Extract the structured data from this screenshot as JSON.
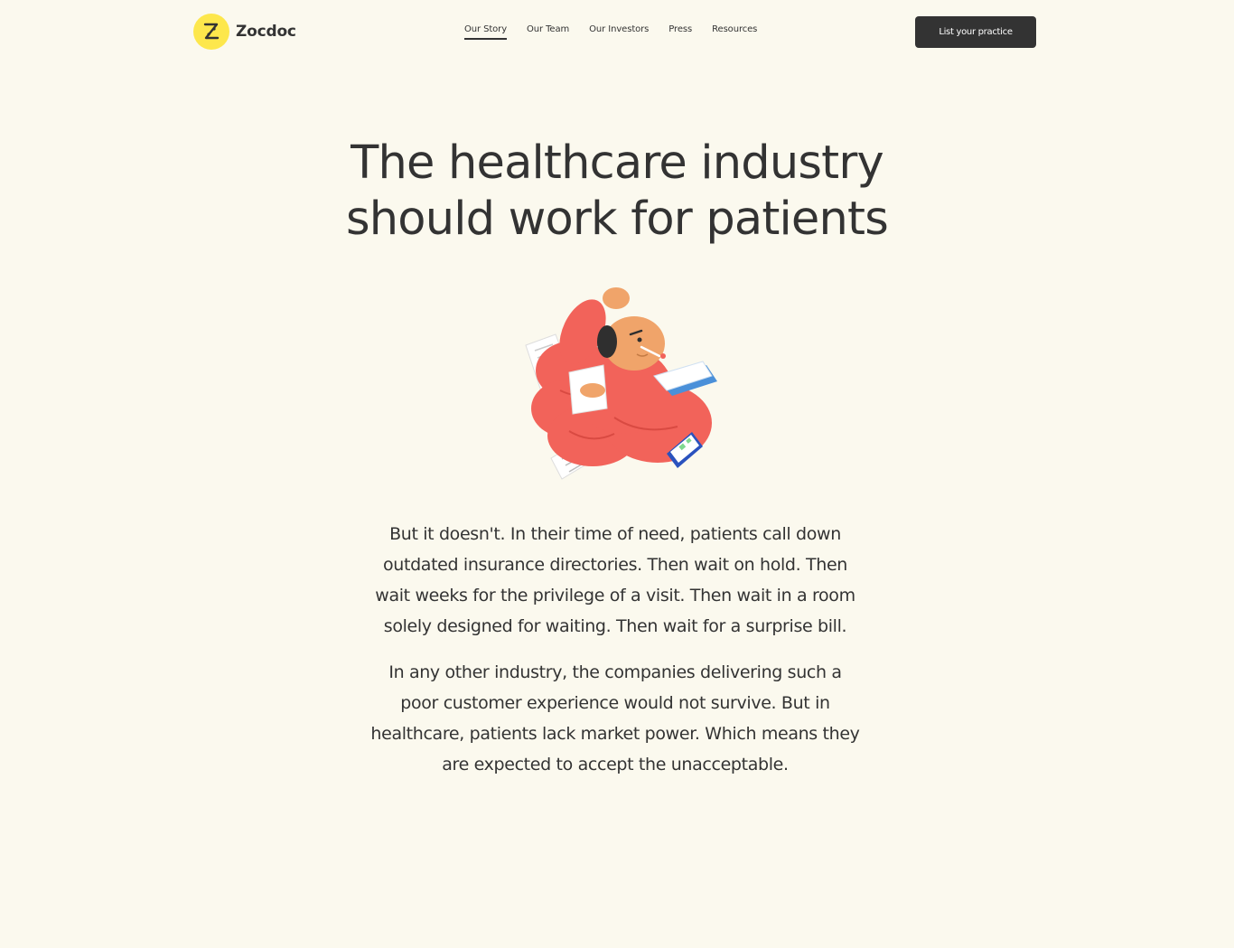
{
  "brand": {
    "name": "Zocdoc",
    "logo_icon": "zocdoc-z-logo",
    "colors": {
      "background": "#fbf9ee",
      "logo_yellow": "#fde74c",
      "text": "#333333",
      "button_bg": "#333333",
      "illustration_red": "#f2635a",
      "illustration_skin": "#f0a46a"
    }
  },
  "nav": {
    "items": [
      {
        "label": "Our Story",
        "active": true
      },
      {
        "label": "Our Team",
        "active": false
      },
      {
        "label": "Our Investors",
        "active": false
      },
      {
        "label": "Press",
        "active": false
      },
      {
        "label": "Resources",
        "active": false
      }
    ],
    "cta_label": "List your practice"
  },
  "hero": {
    "headline_line1": "The healthcare industry",
    "headline_line2": "should work for patients",
    "illustration": "frustrated-patient-illustration"
  },
  "body": {
    "paragraph1": "But it doesn't. In their time of need, patients call down outdated insurance directories. Then wait on hold. Then wait weeks for the privilege of a visit. Then wait in a room solely designed for waiting. Then wait for a surprise bill.",
    "paragraph2": "In any other industry, the companies delivering such a poor customer experience would not survive. But in healthcare, patients lack market power. Which means they are expected to accept the unacceptable."
  }
}
